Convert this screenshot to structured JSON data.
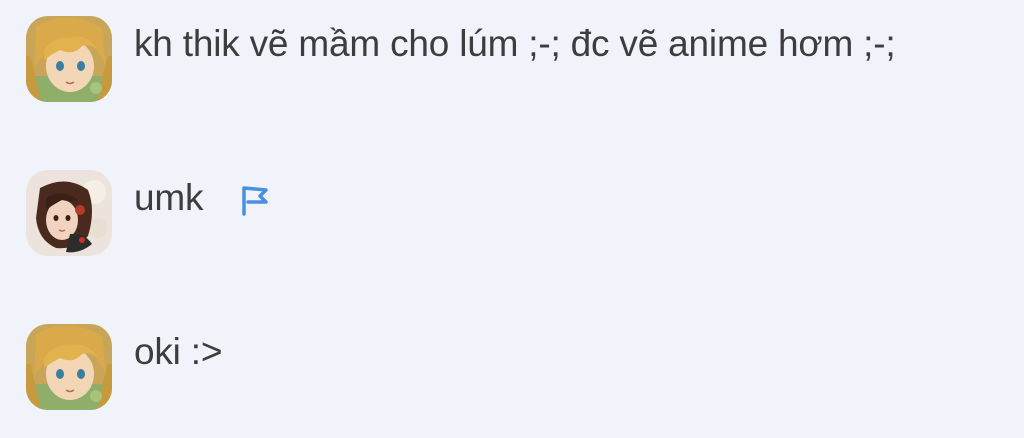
{
  "messages": [
    {
      "avatar": "anime-boy-avatar",
      "text": "kh thik vẽ mầm cho lúm ;-; đc vẽ anime hơm ;-;"
    },
    {
      "avatar": "girl-avatar",
      "text": "umk",
      "flag_icon": "flag-icon"
    },
    {
      "avatar": "anime-boy-avatar",
      "text": "oki :>"
    }
  ],
  "colors": {
    "background": "#f0f3f9",
    "text": "#3d3d3d",
    "flag": "#4a90e2"
  }
}
